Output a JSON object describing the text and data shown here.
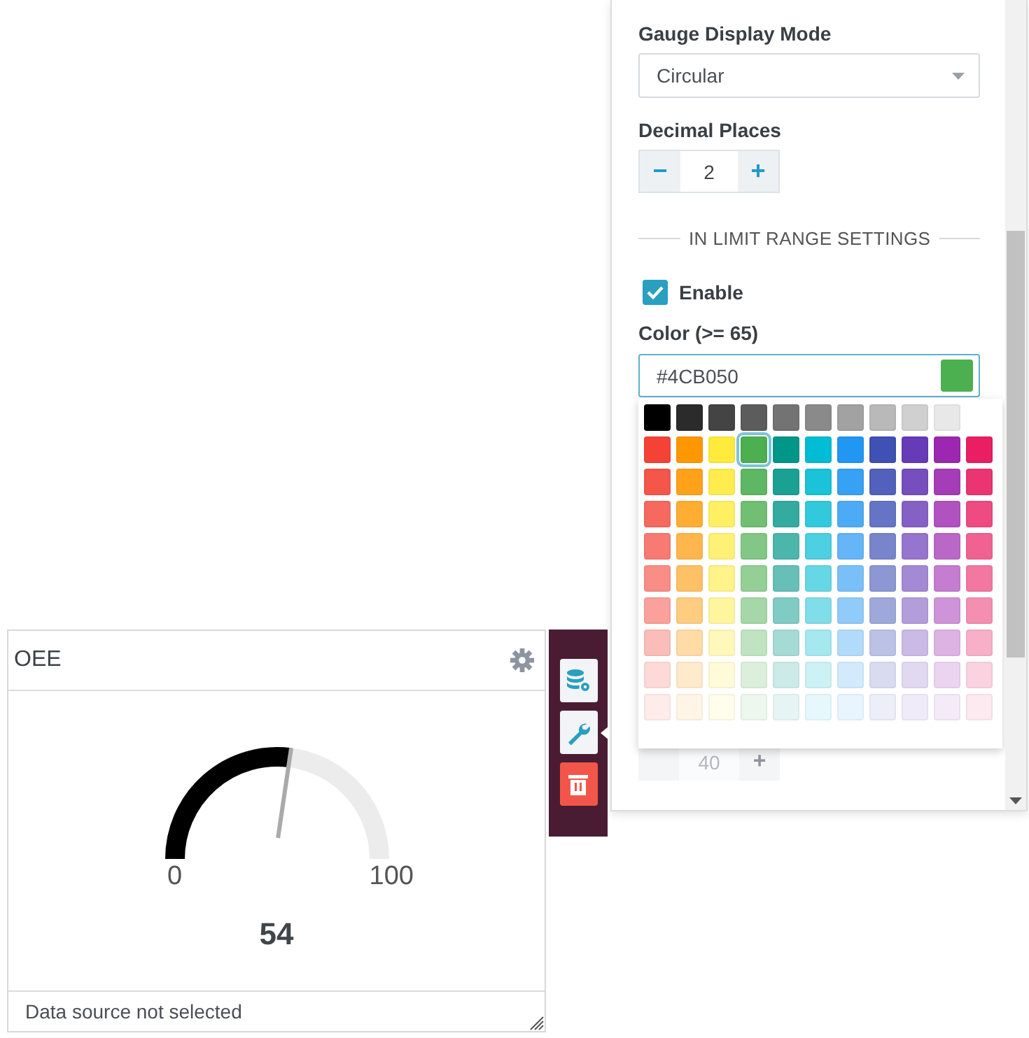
{
  "panel": {
    "display_mode": {
      "label": "Gauge Display Mode",
      "value": "Circular"
    },
    "decimal_places": {
      "label": "Decimal Places",
      "decrement": "−",
      "value": "2",
      "increment": "+"
    },
    "in_limit": {
      "heading": "IN LIMIT RANGE SETTINGS",
      "enable": {
        "label": "Enable",
        "checked": true
      },
      "color_label": "Color (>= 65)",
      "color_value": "#4CB050"
    },
    "palette": {
      "rows": [
        [
          {
            "color": "#000000",
            "selected": false
          },
          {
            "color": "#2b2b2b",
            "selected": false
          },
          {
            "color": "#444444",
            "selected": false
          },
          {
            "color": "#5c5c5c",
            "selected": false
          },
          {
            "color": "#737373",
            "selected": false
          },
          {
            "color": "#8a8a8a",
            "selected": false
          },
          {
            "color": "#a2a2a2",
            "selected": false
          },
          {
            "color": "#b9b9b9",
            "selected": false
          },
          {
            "color": "#d0d0d0",
            "selected": false
          },
          {
            "color": "#e8e8e8",
            "selected": false
          }
        ],
        [
          {
            "color": "#f44336",
            "selected": false
          },
          {
            "color": "#ff9800",
            "selected": false
          },
          {
            "color": "#ffeb3b",
            "selected": false
          },
          {
            "color": "#4cb050",
            "selected": true
          },
          {
            "color": "#009688",
            "selected": false
          },
          {
            "color": "#00bcd4",
            "selected": false
          },
          {
            "color": "#2196f3",
            "selected": false
          },
          {
            "color": "#3f51b5",
            "selected": false
          },
          {
            "color": "#673ab7",
            "selected": false
          },
          {
            "color": "#9c27b0",
            "selected": false
          },
          {
            "color": "#e91e63",
            "selected": false
          }
        ],
        [
          {
            "color": "#f5564a",
            "selected": false
          },
          {
            "color": "#ffa21a",
            "selected": false
          },
          {
            "color": "#ffed4f",
            "selected": false
          },
          {
            "color": "#5eb762",
            "selected": false
          },
          {
            "color": "#1aa194",
            "selected": false
          },
          {
            "color": "#1ac3d8",
            "selected": false
          },
          {
            "color": "#37a1f4",
            "selected": false
          },
          {
            "color": "#5262bc",
            "selected": false
          },
          {
            "color": "#764ebe",
            "selected": false
          },
          {
            "color": "#a63db8",
            "selected": false
          },
          {
            "color": "#eb3573",
            "selected": false
          }
        ],
        [
          {
            "color": "#f6695e",
            "selected": false
          },
          {
            "color": "#ffad33",
            "selected": false
          },
          {
            "color": "#ffef62",
            "selected": false
          },
          {
            "color": "#70bf73",
            "selected": false
          },
          {
            "color": "#33aba0",
            "selected": false
          },
          {
            "color": "#33c9dd",
            "selected": false
          },
          {
            "color": "#4dabf5",
            "selected": false
          },
          {
            "color": "#6574c4",
            "selected": false
          },
          {
            "color": "#8561c5",
            "selected": false
          },
          {
            "color": "#b052c0",
            "selected": false
          },
          {
            "color": "#ed4b82",
            "selected": false
          }
        ],
        [
          {
            "color": "#f77b72",
            "selected": false
          },
          {
            "color": "#ffb74d",
            "selected": false
          },
          {
            "color": "#fff176",
            "selected": false
          },
          {
            "color": "#82c785",
            "selected": false
          },
          {
            "color": "#4db6ac",
            "selected": false
          },
          {
            "color": "#4dd0e1",
            "selected": false
          },
          {
            "color": "#64b6f7",
            "selected": false
          },
          {
            "color": "#7985cb",
            "selected": false
          },
          {
            "color": "#9575cd",
            "selected": false
          },
          {
            "color": "#ba68c8",
            "selected": false
          },
          {
            "color": "#f06292",
            "selected": false
          }
        ],
        [
          {
            "color": "#f88e86",
            "selected": false
          },
          {
            "color": "#ffc166",
            "selected": false
          },
          {
            "color": "#fff389",
            "selected": false
          },
          {
            "color": "#94cf96",
            "selected": false
          },
          {
            "color": "#66c0b8",
            "selected": false
          },
          {
            "color": "#66d7e5",
            "selected": false
          },
          {
            "color": "#7ac0f8",
            "selected": false
          },
          {
            "color": "#8c97d3",
            "selected": false
          },
          {
            "color": "#a489d4",
            "selected": false
          },
          {
            "color": "#c47dd0",
            "selected": false
          },
          {
            "color": "#f278a1",
            "selected": false
          }
        ],
        [
          {
            "color": "#faa19b",
            "selected": false
          },
          {
            "color": "#ffcc80",
            "selected": false
          },
          {
            "color": "#fff59d",
            "selected": false
          },
          {
            "color": "#a6d7a8",
            "selected": false
          },
          {
            "color": "#80cbc4",
            "selected": false
          },
          {
            "color": "#80deea",
            "selected": false
          },
          {
            "color": "#90cbf9",
            "selected": false
          },
          {
            "color": "#9fa8da",
            "selected": false
          },
          {
            "color": "#b39ddb",
            "selected": false
          },
          {
            "color": "#ce93d8",
            "selected": false
          },
          {
            "color": "#f48fb1",
            "selected": false
          }
        ],
        [
          {
            "color": "#fbbdb9",
            "selected": false
          },
          {
            "color": "#ffdba6",
            "selected": false
          },
          {
            "color": "#fff8ba",
            "selected": false
          },
          {
            "color": "#c0e3c2",
            "selected": false
          },
          {
            "color": "#a6dad5",
            "selected": false
          },
          {
            "color": "#a6e8f0",
            "selected": false
          },
          {
            "color": "#b1dafb",
            "selected": false
          },
          {
            "color": "#bcc2e5",
            "selected": false
          },
          {
            "color": "#cabae6",
            "selected": false
          },
          {
            "color": "#dcb3e3",
            "selected": false
          },
          {
            "color": "#f7b0c8",
            "selected": false
          }
        ],
        [
          {
            "color": "#fdd9d7",
            "selected": false
          },
          {
            "color": "#ffeacc",
            "selected": false
          },
          {
            "color": "#fffbd8",
            "selected": false
          },
          {
            "color": "#dbefdc",
            "selected": false
          },
          {
            "color": "#cceae7",
            "selected": false
          },
          {
            "color": "#ccf2f6",
            "selected": false
          },
          {
            "color": "#d3eafd",
            "selected": false
          },
          {
            "color": "#d9dcf0",
            "selected": false
          },
          {
            "color": "#e1d8f1",
            "selected": false
          },
          {
            "color": "#ebd4ef",
            "selected": false
          },
          {
            "color": "#fbd2e0",
            "selected": false
          }
        ],
        [
          {
            "color": "#feeceb",
            "selected": false
          },
          {
            "color": "#fff5e6",
            "selected": false
          },
          {
            "color": "#fffdeb",
            "selected": false
          },
          {
            "color": "#edf7ed",
            "selected": false
          },
          {
            "color": "#e6f5f3",
            "selected": false
          },
          {
            "color": "#e6f8fb",
            "selected": false
          },
          {
            "color": "#e9f5fe",
            "selected": false
          },
          {
            "color": "#eceef8",
            "selected": false
          },
          {
            "color": "#f0ebf8",
            "selected": false
          },
          {
            "color": "#f5eaf7",
            "selected": false
          },
          {
            "color": "#fde9f0",
            "selected": false
          }
        ]
      ]
    },
    "covered_stepper": {
      "value": "40",
      "increment": "+"
    }
  },
  "widget": {
    "title": "OEE",
    "gauge": {
      "level": 0.54,
      "min_label": "0",
      "max_label": "100",
      "value": "54"
    },
    "footer": "Data source not selected"
  },
  "toolbar": {
    "tools": [
      {
        "kind": "data-source",
        "selected": false
      },
      {
        "kind": "settings",
        "selected": true
      },
      {
        "kind": "delete",
        "selected": false
      }
    ]
  }
}
